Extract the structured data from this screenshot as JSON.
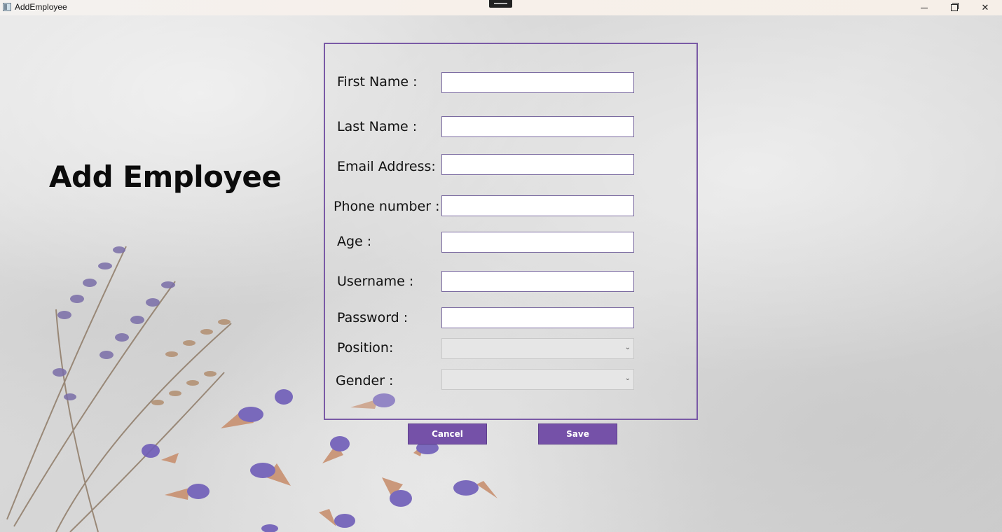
{
  "window": {
    "title": "AddEmployee",
    "controls": [
      "minimize-icon",
      "maximize-icon",
      "close-icon"
    ]
  },
  "page": {
    "title": "Add Employee"
  },
  "form": {
    "fields": [
      {
        "label": "First Name :",
        "value": "",
        "type": "text"
      },
      {
        "label": "Last Name :",
        "value": "",
        "type": "text"
      },
      {
        "label": "Email Address:",
        "value": "",
        "type": "text"
      },
      {
        "label": "Phone number :",
        "value": "",
        "type": "text"
      },
      {
        "label": "Age :",
        "value": "",
        "type": "text"
      },
      {
        "label": "Username :",
        "value": "",
        "type": "text"
      },
      {
        "label": "Password :",
        "value": "",
        "type": "password"
      }
    ],
    "position": {
      "label": "Position:",
      "selected": ""
    },
    "gender": {
      "label": "Gender :",
      "selected": ""
    }
  },
  "actions": {
    "cancel_label": "Cancel",
    "save_label": "Save"
  },
  "colors": {
    "accent": "#7551a8",
    "panel_border": "#7a5aa6",
    "background": "#d9d9d9"
  }
}
